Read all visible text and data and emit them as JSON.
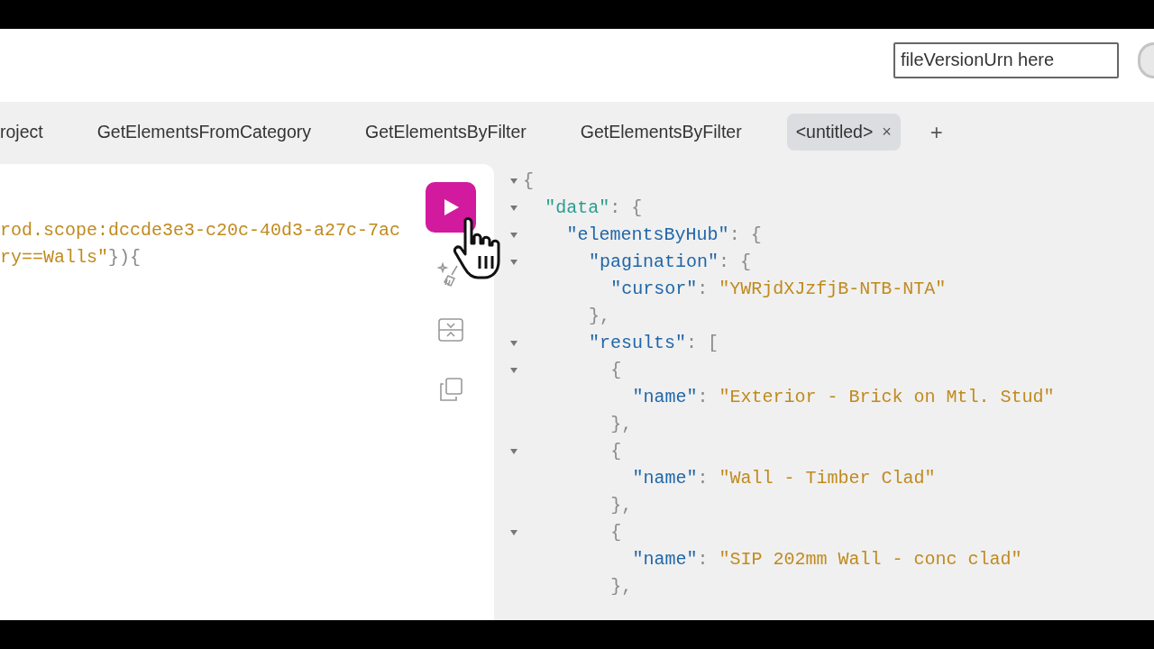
{
  "header": {
    "urn_field": {
      "placeholder": "fileVersionUrn here"
    }
  },
  "tabs": [
    {
      "label": "roject",
      "selected": false
    },
    {
      "label": "GetElementsFromCategory",
      "selected": false
    },
    {
      "label": "GetElementsByFilter",
      "selected": false
    },
    {
      "label": "GetElementsByFilter",
      "selected": false
    },
    {
      "label": "<untitled>",
      "selected": true,
      "close": "×"
    }
  ],
  "new_tab": "+",
  "editor": {
    "lines": [
      [
        {
          "kind": "string",
          "text": "rod.scope:dccde3e3-c20c-40d3-a27c-7ac"
        }
      ],
      [
        {
          "kind": "string",
          "text": "ry==Walls\""
        },
        {
          "kind": "punct",
          "text": "}){"
        }
      ]
    ]
  },
  "result": {
    "separator": ": ",
    "root": {
      "open": "{",
      "expanded": true,
      "children": [
        {
          "key": "\"data\"",
          "open": "{",
          "expanded": true,
          "children": [
            {
              "key": "\"elementsByHub\"",
              "open": "{",
              "expanded": true,
              "children": [
                {
                  "key": "\"pagination\"",
                  "open": "{",
                  "expanded": true,
                  "close": "},",
                  "children": [
                    {
                      "key": "\"cursor\"",
                      "value": "\"YWRjdXJzfjB-NTB-NTA\""
                    }
                  ]
                },
                {
                  "key": "\"results\"",
                  "open": "[",
                  "expanded": true,
                  "children": [
                    {
                      "open": "{",
                      "expanded": true,
                      "close": "},",
                      "children": [
                        {
                          "key": "\"name\"",
                          "value": "\"Exterior - Brick on Mtl. Stud\""
                        }
                      ]
                    },
                    {
                      "open": "{",
                      "expanded": true,
                      "close": "},",
                      "children": [
                        {
                          "key": "\"name\"",
                          "value": "\"Wall - Timber Clad\""
                        }
                      ]
                    },
                    {
                      "open": "{",
                      "expanded": true,
                      "close": "},",
                      "children": [
                        {
                          "key": "\"name\"",
                          "value": "\"SIP 202mm Wall - conc clad\""
                        }
                      ]
                    }
                  ]
                }
              ]
            }
          ]
        }
      ]
    }
  }
}
